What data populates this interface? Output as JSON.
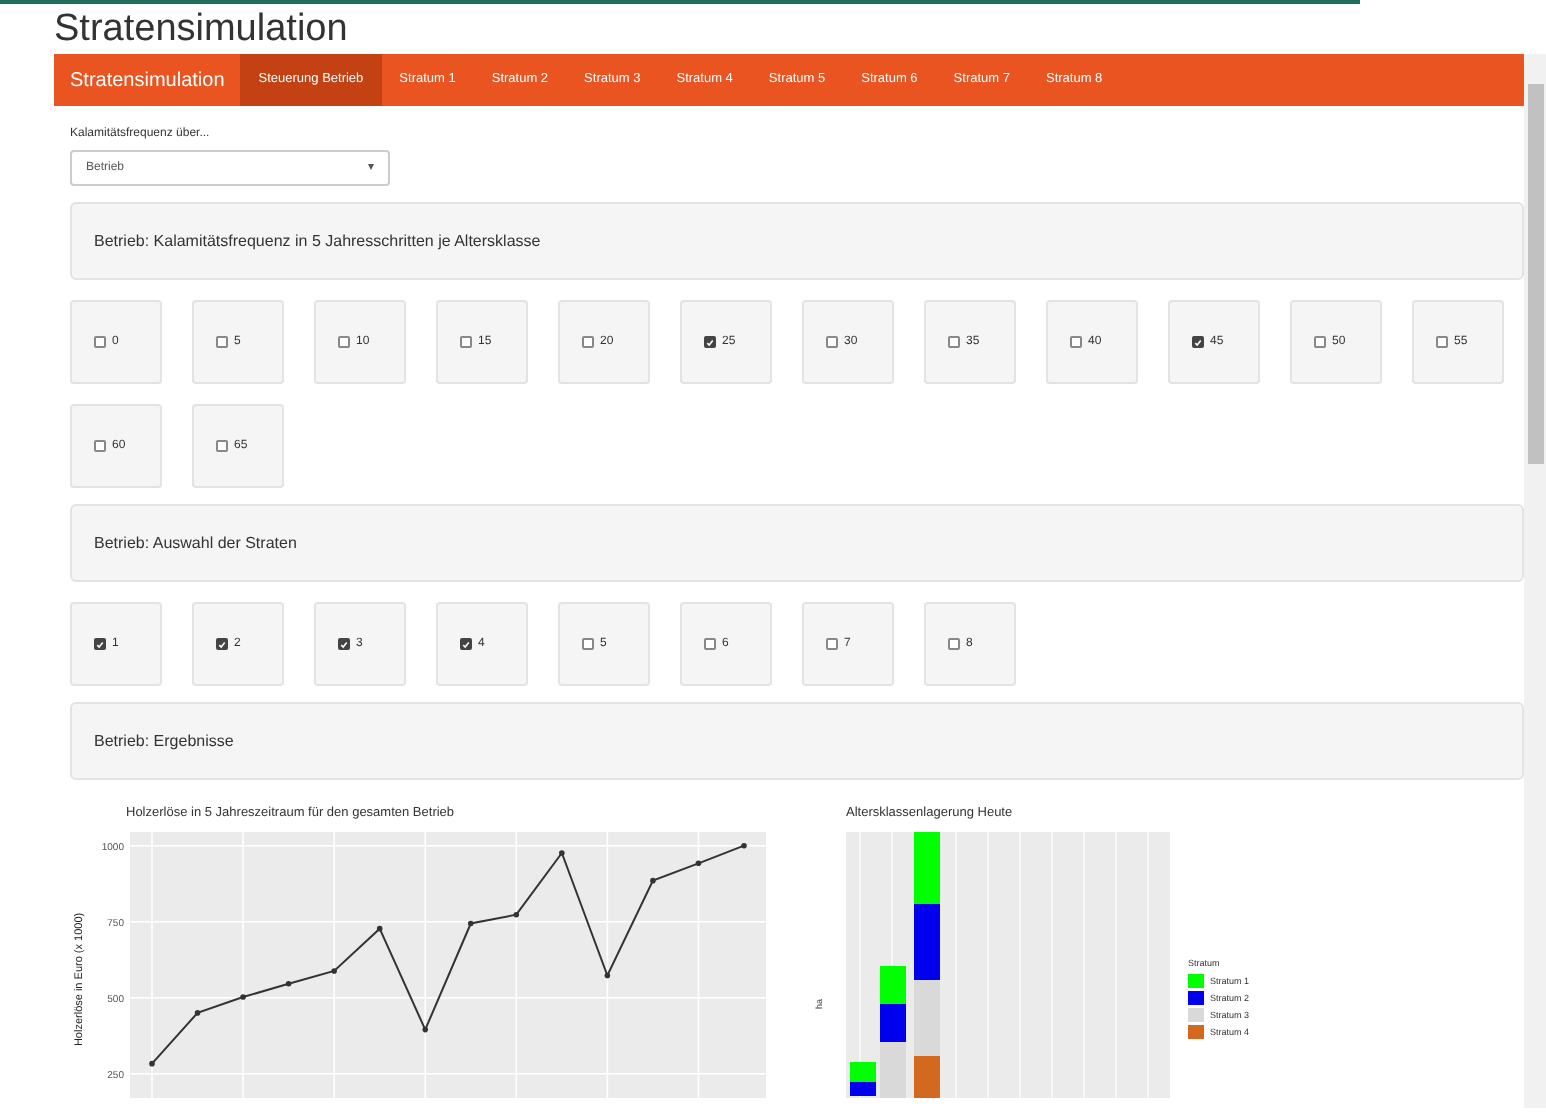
{
  "page_title": "Stratensimulation",
  "navbar": {
    "brand": "Stratensimulation",
    "tabs": [
      {
        "label": "Steuerung Betrieb",
        "selected": true
      },
      {
        "label": "Stratum 1",
        "selected": false
      },
      {
        "label": "Stratum 2",
        "selected": false
      },
      {
        "label": "Stratum 3",
        "selected": false
      },
      {
        "label": "Stratum 4",
        "selected": false
      },
      {
        "label": "Stratum 5",
        "selected": false
      },
      {
        "label": "Stratum 6",
        "selected": false
      },
      {
        "label": "Stratum 7",
        "selected": false
      },
      {
        "label": "Stratum 8",
        "selected": false
      }
    ]
  },
  "select": {
    "label": "Kalamitätsfrequenz über...",
    "value": "Betrieb",
    "caret": "▾"
  },
  "sections": [
    {
      "heading": "Betrieb: Kalamitätsfrequenz in 5 Jahresschritten je Altersklasse",
      "options": [
        {
          "label": "0",
          "checked": false
        },
        {
          "label": "5",
          "checked": false
        },
        {
          "label": "10",
          "checked": false
        },
        {
          "label": "15",
          "checked": false
        },
        {
          "label": "20",
          "checked": false
        },
        {
          "label": "25",
          "checked": true
        },
        {
          "label": "30",
          "checked": false
        },
        {
          "label": "35",
          "checked": false
        },
        {
          "label": "40",
          "checked": false
        },
        {
          "label": "45",
          "checked": true
        },
        {
          "label": "50",
          "checked": false
        },
        {
          "label": "55",
          "checked": false
        },
        {
          "label": "60",
          "checked": false
        },
        {
          "label": "65",
          "checked": false
        }
      ]
    },
    {
      "heading": "Betrieb: Auswahl der Straten",
      "options": [
        {
          "label": "1",
          "checked": true
        },
        {
          "label": "2",
          "checked": true
        },
        {
          "label": "3",
          "checked": true
        },
        {
          "label": "4",
          "checked": true
        },
        {
          "label": "5",
          "checked": false
        },
        {
          "label": "6",
          "checked": false
        },
        {
          "label": "7",
          "checked": false
        },
        {
          "label": "8",
          "checked": false
        }
      ]
    },
    {
      "heading": "Betrieb: Ergebnisse"
    }
  ],
  "line_chart": {
    "chart_data": {
      "type": "line",
      "title": "Holzerlöse in 5 Jahreszeitraum für den gesamten Betrieb",
      "ylabel": "Holzerlöse in Euro (x 1000)",
      "yticks": [
        250,
        500,
        750,
        1000
      ],
      "ylim": [
        170,
        1045
      ],
      "grid": true,
      "series": [
        {
          "color": "#333333",
          "values": [
            283,
            450,
            502,
            546,
            588,
            727,
            395,
            744,
            773,
            976,
            573,
            885,
            942,
            1000
          ]
        }
      ]
    }
  },
  "bar_chart": {
    "title": "Altersklassenlagerung Heute",
    "ylabel": "ha",
    "legend_title": "Stratum",
    "legend": [
      {
        "label": "Stratum 1",
        "color": "#00ff00"
      },
      {
        "label": "Stratum 2",
        "color": "#0000ee"
      },
      {
        "label": "Stratum 3",
        "color": "#d9d9d9"
      },
      {
        "label": "Stratum 4",
        "color": "#d2691e"
      }
    ]
  }
}
